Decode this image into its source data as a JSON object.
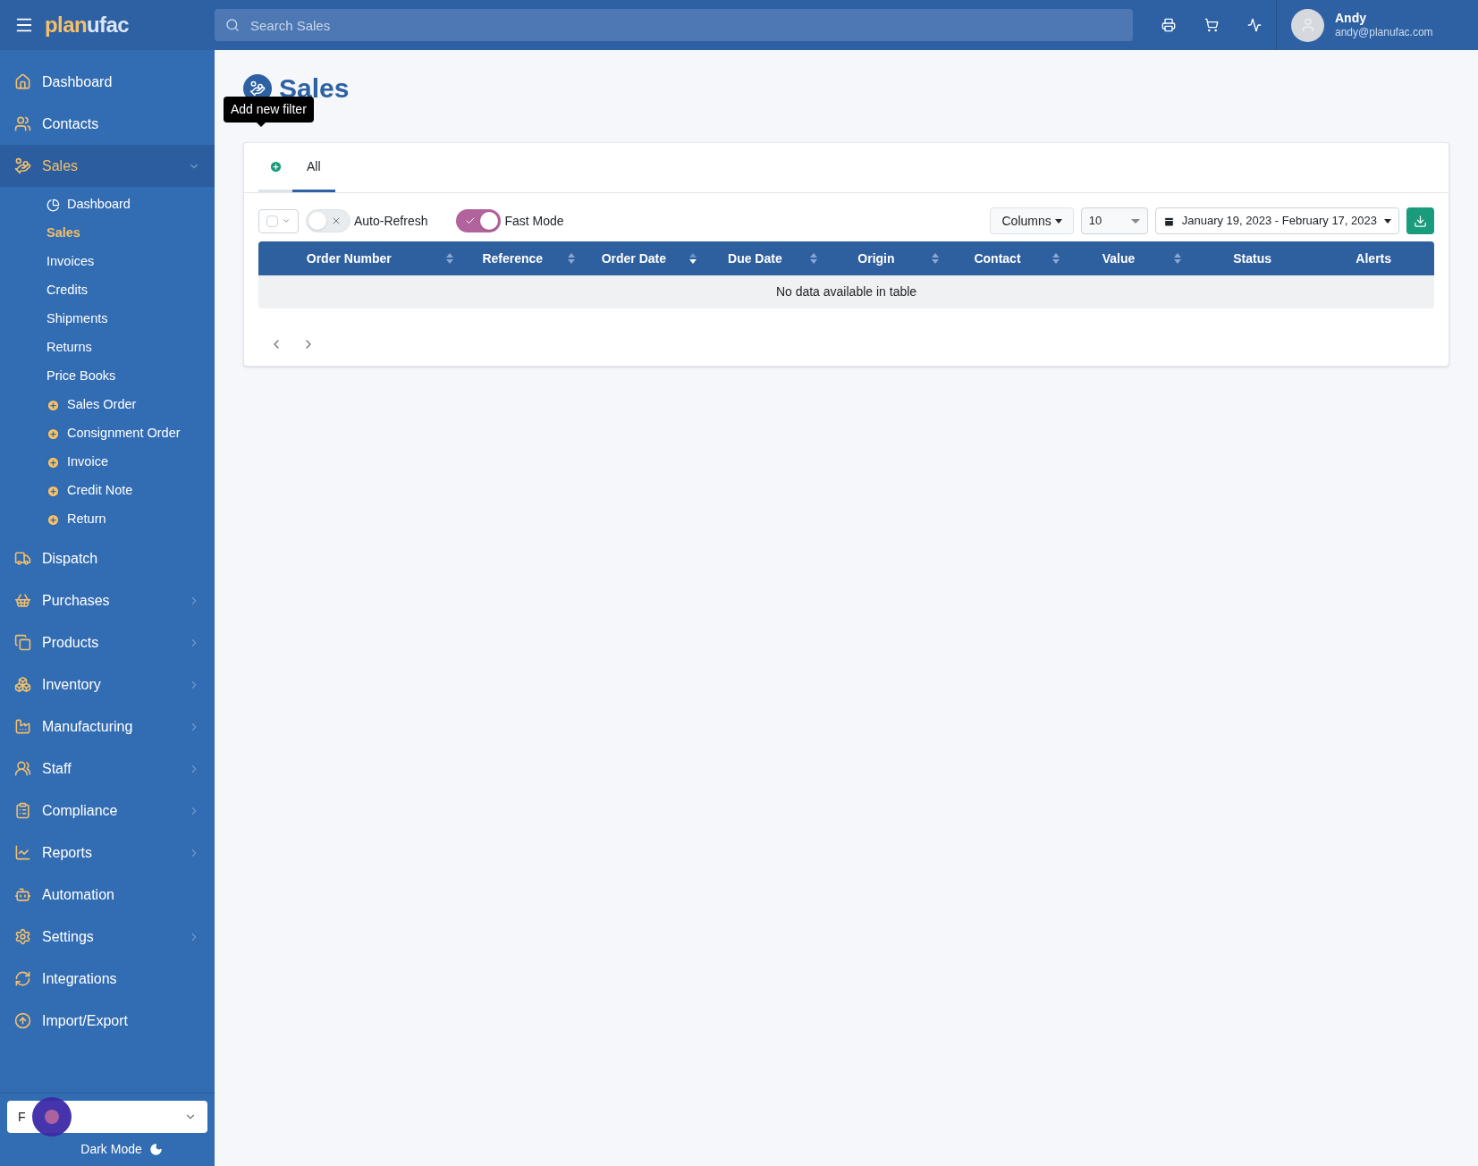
{
  "header": {
    "logo_part1": "plan",
    "logo_part2": "ufac",
    "search": {
      "placeholder": "Search Sales"
    },
    "user": {
      "name": "Andy",
      "email": "andy@planufac.com"
    }
  },
  "sidebar": {
    "items": [
      {
        "label": "Dashboard",
        "selected": false,
        "expandable": false
      },
      {
        "label": "Contacts",
        "selected": false,
        "expandable": false
      },
      {
        "label": "Sales",
        "selected": true,
        "expandable": true,
        "expanded": true,
        "children": [
          {
            "label": "Dashboard",
            "kind": "icon",
            "selected": false
          },
          {
            "label": "Sales",
            "kind": "link",
            "selected": true
          },
          {
            "label": "Invoices",
            "kind": "link",
            "selected": false
          },
          {
            "label": "Credits",
            "kind": "link",
            "selected": false
          },
          {
            "label": "Shipments",
            "kind": "link",
            "selected": false
          },
          {
            "label": "Returns",
            "kind": "link",
            "selected": false
          },
          {
            "label": "Price Books",
            "kind": "link",
            "selected": false
          },
          {
            "label": "Sales Order",
            "kind": "create",
            "selected": false
          },
          {
            "label": "Consignment Order",
            "kind": "create",
            "selected": false
          },
          {
            "label": "Invoice",
            "kind": "create",
            "selected": false
          },
          {
            "label": "Credit Note",
            "kind": "create",
            "selected": false
          },
          {
            "label": "Return",
            "kind": "create",
            "selected": false
          }
        ]
      },
      {
        "label": "Dispatch",
        "selected": false,
        "expandable": false
      },
      {
        "label": "Purchases",
        "selected": false,
        "expandable": true,
        "expanded": false
      },
      {
        "label": "Products",
        "selected": false,
        "expandable": true,
        "expanded": false
      },
      {
        "label": "Inventory",
        "selected": false,
        "expandable": true,
        "expanded": false
      },
      {
        "label": "Manufacturing",
        "selected": false,
        "expandable": true,
        "expanded": false
      },
      {
        "label": "Staff",
        "selected": false,
        "expandable": true,
        "expanded": false
      },
      {
        "label": "Compliance",
        "selected": false,
        "expandable": true,
        "expanded": false
      },
      {
        "label": "Reports",
        "selected": false,
        "expandable": true,
        "expanded": false
      },
      {
        "label": "Automation",
        "selected": false,
        "expandable": false
      },
      {
        "label": "Settings",
        "selected": false,
        "expandable": true,
        "expanded": false
      },
      {
        "label": "Integrations",
        "selected": false,
        "expandable": false
      },
      {
        "label": "Import/Export",
        "selected": false,
        "expandable": false
      }
    ],
    "select_value": "F",
    "dark_mode": {
      "label": "Dark Mode"
    }
  },
  "page": {
    "title": "Sales",
    "tooltip": "Add new filter",
    "tabs": [
      {
        "label": "All",
        "selected": true
      }
    ],
    "toolbar": {
      "select_all": {
        "checked": false
      },
      "auto_refresh": {
        "label": "Auto-Refresh",
        "on": false
      },
      "fast_mode": {
        "label": "Fast Mode",
        "on": true
      },
      "columns_button": "Columns",
      "rows_choice": "10",
      "date_range": "January 19, 2023 - February 17, 2023"
    },
    "table": {
      "columns": [
        {
          "label": "Order Number",
          "sortable": true,
          "sorted": false
        },
        {
          "label": "Reference",
          "sortable": true,
          "sorted": false
        },
        {
          "label": "Order Date",
          "sortable": true,
          "sorted": true
        },
        {
          "label": "Due Date",
          "sortable": true,
          "sorted": false
        },
        {
          "label": "Origin",
          "sortable": true,
          "sorted": false
        },
        {
          "label": "Contact",
          "sortable": true,
          "sorted": false
        },
        {
          "label": "Value",
          "sortable": true,
          "sorted": false
        },
        {
          "label": "Status",
          "sortable": false
        },
        {
          "label": "Alerts",
          "sortable": false
        }
      ],
      "empty_message": "No data available in table"
    }
  }
}
